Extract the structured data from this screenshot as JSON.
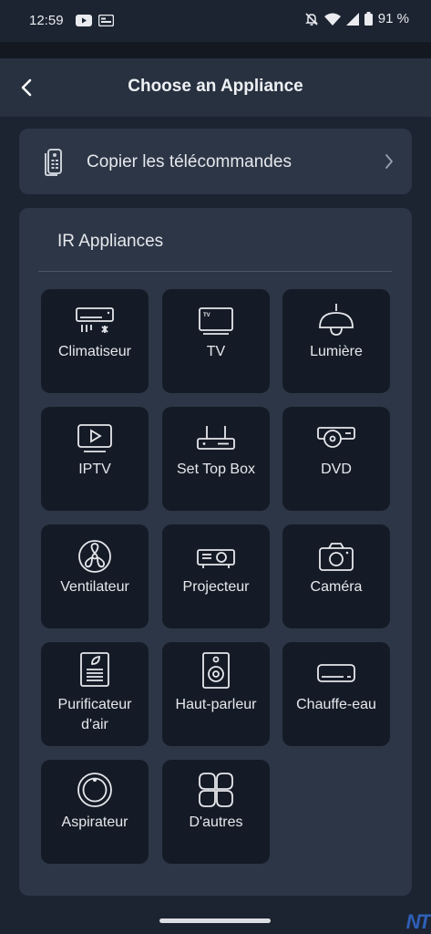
{
  "status_bar": {
    "time": "12:59",
    "battery": "91 %"
  },
  "header": {
    "title": "Choose an Appliance"
  },
  "copy_remotes": {
    "label": "Copier les télécommandes"
  },
  "ir_section": {
    "title": "IR Appliances",
    "items": [
      {
        "label": "Climatiseur",
        "icon": "air-conditioner-icon"
      },
      {
        "label": "TV",
        "icon": "tv-icon"
      },
      {
        "label": "Lumière",
        "icon": "lamp-icon"
      },
      {
        "label": "IPTV",
        "icon": "iptv-icon"
      },
      {
        "label": "Set Top Box",
        "icon": "set-top-box-icon"
      },
      {
        "label": "DVD",
        "icon": "dvd-icon"
      },
      {
        "label": "Ventilateur",
        "icon": "fan-icon"
      },
      {
        "label": "Projecteur",
        "icon": "projector-icon"
      },
      {
        "label": "Caméra",
        "icon": "camera-icon"
      },
      {
        "label": "Purificateur d'air",
        "icon": "air-purifier-icon"
      },
      {
        "label": "Haut-parleur",
        "icon": "speaker-icon"
      },
      {
        "label": "Chauffe-eau",
        "icon": "water-heater-icon"
      },
      {
        "label": "Aspirateur",
        "icon": "robot-vacuum-icon"
      },
      {
        "label": "D'autres",
        "icon": "others-icon"
      }
    ]
  },
  "watermark": "NT",
  "colors": {
    "background": "#1c2431",
    "card": "#2c3646",
    "tile": "#151b26",
    "text": "#e6e8ec"
  }
}
